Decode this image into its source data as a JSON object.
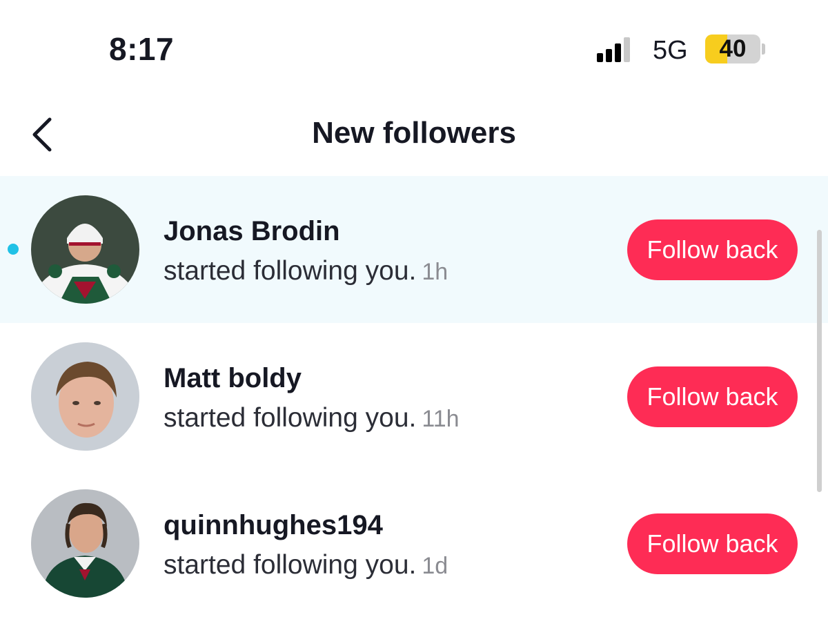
{
  "status_bar": {
    "time": "8:17",
    "network": "5G",
    "battery_percent": "40",
    "battery_level": 0.4,
    "signal_bars_active": 3,
    "signal_bars_total": 4
  },
  "header": {
    "title": "New followers",
    "back_icon": "chevron-left-icon"
  },
  "followers": [
    {
      "name": "Jonas Brodin",
      "action": "started following you.",
      "time": "1h",
      "button": "Follow back",
      "unread": true
    },
    {
      "name": "Matt boldy",
      "action": "started following you.",
      "time": "11h",
      "button": "Follow back",
      "unread": false
    },
    {
      "name": "quinnhughes194",
      "action": "started following you.",
      "time": "1d",
      "button": "Follow back",
      "unread": false
    }
  ],
  "colors": {
    "accent": "#fe2c55",
    "unread_dot": "#20c1e6",
    "unread_row_bg": "#f1fafd",
    "battery_fill": "#f7cd1e"
  }
}
